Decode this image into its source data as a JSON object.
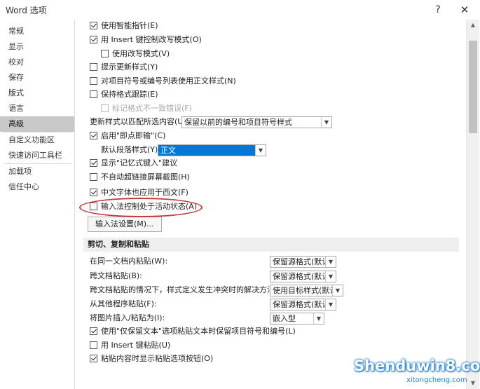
{
  "window": {
    "title": "Word 选项",
    "help": "?",
    "close": "✕"
  },
  "sidebar": {
    "items": [
      {
        "label": "常规"
      },
      {
        "label": "显示"
      },
      {
        "label": "校对"
      },
      {
        "label": "保存"
      },
      {
        "label": "版式"
      },
      {
        "label": "语言"
      },
      {
        "label": "高级",
        "selected": true
      },
      {
        "label": "自定义功能区"
      },
      {
        "label": "快速访问工具栏"
      },
      {
        "label": "加载项"
      },
      {
        "label": "信任中心"
      }
    ]
  },
  "options": {
    "smart_cursor": {
      "label": "使用智能指针(E)",
      "checked": true
    },
    "insert_key_overtype": {
      "label": "用 Insert 键控制改写模式(O)",
      "checked": true
    },
    "use_overtype": {
      "label": "使用改写模式(V)",
      "checked": false
    },
    "prompt_update_style": {
      "label": "提示更新样式(Y)",
      "checked": false
    },
    "normal_style_for_lists": {
      "label": "对项目符号或编号列表使用正文样式(N)",
      "checked": false
    },
    "track_formatting": {
      "label": "保持格式跟踪(E)",
      "checked": false
    },
    "mark_inconsistency": {
      "label": "标记格式不一致错误(F)",
      "checked": false,
      "disabled": true
    },
    "update_style_label": "更新样式以匹配所选内容(U):",
    "update_style_value": "保留以前的编号和项目符号样式",
    "click_and_type": {
      "label": "启用\"即点即输\"(C)",
      "checked": true
    },
    "default_para_label": "默认段落样式(Y):",
    "default_para_value": "正文",
    "autocomplete": {
      "label": "显示\"记忆式键入\"建议",
      "checked": true
    },
    "auto_screenshot_link": {
      "label": "不自动超链接屏幕截图(H)",
      "checked": false
    },
    "cjk_fonts_to_western": {
      "label": "中文字体也应用于西文(F)",
      "checked": true
    },
    "ime_control": {
      "label": "输入法控制处于活动状态(A)",
      "checked": false
    },
    "ime_settings_button": "输入法设置(M)..."
  },
  "cut_copy_paste": {
    "header": "剪切、复制和粘贴",
    "rows": [
      {
        "label": "在同一文档内粘贴(W):",
        "value": "保留源格式(默认)"
      },
      {
        "label": "跨文档粘贴(B):",
        "value": "保留源格式(默认)"
      },
      {
        "label": "跨文档粘贴的情况下，样式定义发生冲突时的解决方法(E):",
        "value": "使用目标样式(默认)"
      },
      {
        "label": "从其他程序粘贴(F):",
        "value": "保留源格式(默认)"
      },
      {
        "label": "将图片插入/粘贴为(I):",
        "value": "嵌入型"
      }
    ],
    "keep_bullets": {
      "label": "使用\"仅保留文本\"选项粘贴文本时保留项目符号和编号(L)",
      "checked": true
    },
    "insert_key_paste": {
      "label": "用 Insert 键粘贴(U)",
      "checked": false
    },
    "show_paste_options": {
      "label": "粘贴内容时显示粘贴选项按钮(O)",
      "checked": true
    }
  },
  "watermark": {
    "logo": "Shenduwin8.com",
    "url": "xitongcheng.com"
  }
}
